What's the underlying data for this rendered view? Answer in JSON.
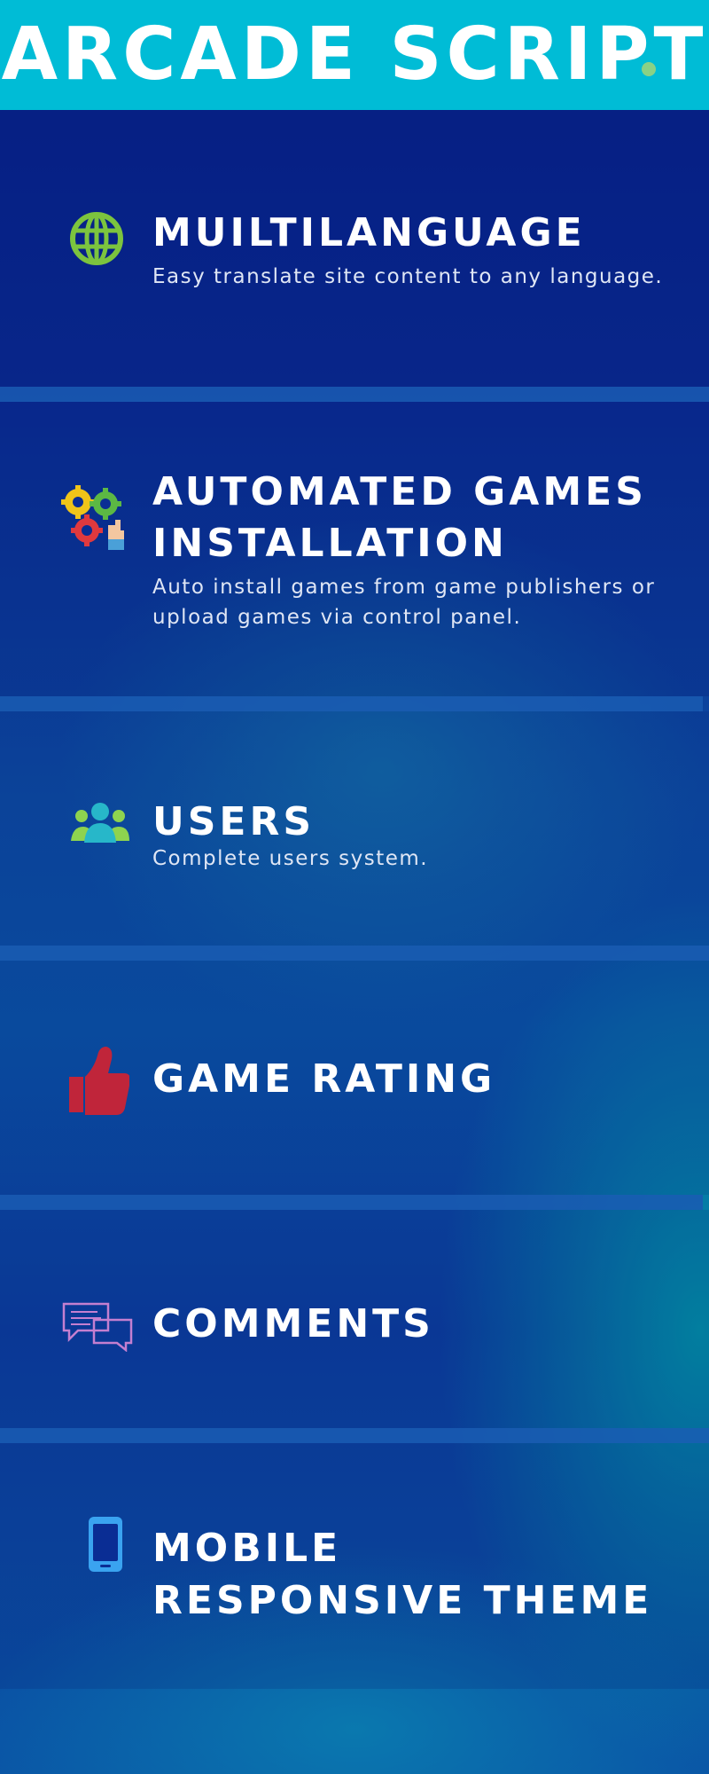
{
  "header": {
    "title": "ARCADE SCRIPT"
  },
  "features": [
    {
      "icon": "globe-icon",
      "title": "MUILTILANGUAGE",
      "description": "Easy translate site content to any language."
    },
    {
      "icon": "gears-icon",
      "title_line1": "AUTOMATED GAMES",
      "title_line2": "INSTALLATION",
      "description_line1": "Auto install games from game publishers or",
      "description_line2": "upload games via control panel."
    },
    {
      "icon": "users-icon",
      "title": "USERS",
      "description": "Complete users system."
    },
    {
      "icon": "thumbs-up-icon",
      "title": "GAME RATING"
    },
    {
      "icon": "chat-bubbles-icon",
      "title": "COMMENTS"
    },
    {
      "icon": "mobile-phone-icon",
      "title_line1": "MOBILE",
      "title_line2": "RESPONSIVE THEME"
    }
  ],
  "colors": {
    "header_bg": "#00bcd6",
    "globe": "#7cc43e",
    "thumbs_up": "#c0253a",
    "comments": "#c47fd0",
    "mobile": "#3aa3f0"
  }
}
